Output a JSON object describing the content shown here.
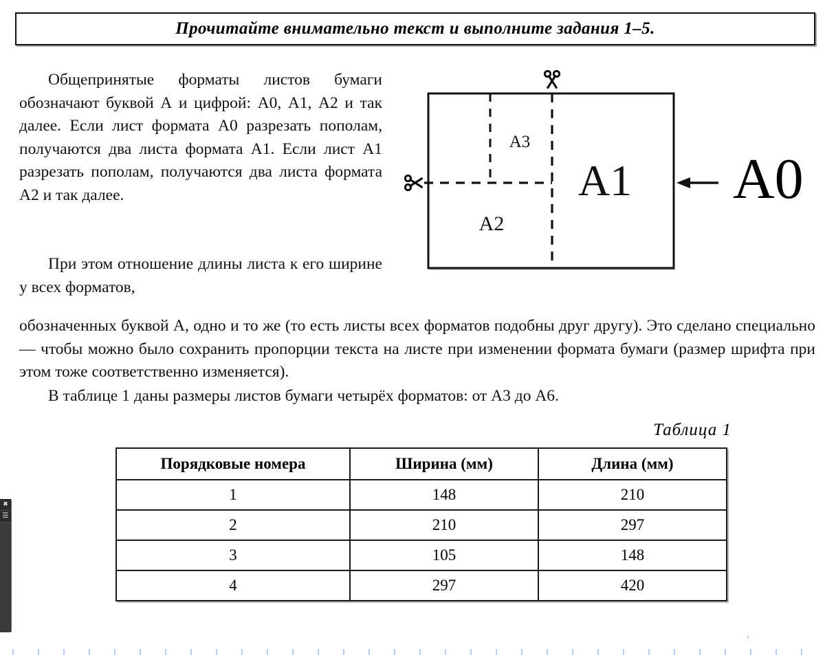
{
  "header": {
    "title": "Прочитайте внимательно текст и выполните задания 1–5."
  },
  "article": {
    "paragraph_1": "Общепринятые форматы листов бумаги обозначают буквой А и цифрой: А0, А1, А2 и так далее. Если лист формата А0 разрезать пополам, получаются два листа формата А1. Если лист А1 разрезать пополам, получаются два листа формата А2 и так далее.",
    "paragraph_2_col": "При этом отношение длины листа к его ширине у всех форматов,",
    "paragraph_2_full": "обозначенных буквой А, одно и то же (то есть листы всех форматов подобны друг другу). Это сделано специально — чтобы можно было сохранить пропорции текста на листе при изменении формата бумаги (размер шрифта при этом тоже соответственно изменяется).",
    "paragraph_3": "В таблице 1 даны размеры листов бумаги четырёх форматов: от А3 до А6."
  },
  "figure": {
    "labels": {
      "a0": "А0",
      "a1": "А1",
      "a2": "А2",
      "a3": "А3"
    },
    "icons": {
      "scissors_top": "scissors-icon",
      "scissors_left": "scissors-icon",
      "arrow": "arrow-left-icon"
    },
    "colors": {
      "stroke": "#111111",
      "fill": "#ffffff"
    }
  },
  "table": {
    "caption": "Таблица 1",
    "columns": [
      "Порядковые номера",
      "Ширина (мм)",
      "Длина (мм)"
    ],
    "rows": [
      [
        "1",
        "148",
        "210"
      ],
      [
        "2",
        "210",
        "297"
      ],
      [
        "3",
        "105",
        "148"
      ],
      [
        "4",
        "297",
        "420"
      ]
    ]
  },
  "toolbar": {
    "close_label": "✖",
    "menu_label": "☰"
  },
  "chart_data": {
    "type": "table",
    "title": "Таблица 1",
    "columns": [
      "Порядковые номера",
      "Ширина (мм)",
      "Длина (мм)"
    ],
    "rows": [
      {
        "index": 1,
        "width_mm": 148,
        "length_mm": 210
      },
      {
        "index": 2,
        "width_mm": 210,
        "length_mm": 297
      },
      {
        "index": 3,
        "width_mm": 105,
        "length_mm": 148
      },
      {
        "index": 4,
        "width_mm": 297,
        "length_mm": 420
      }
    ],
    "xlabel": "",
    "ylabel": ""
  }
}
